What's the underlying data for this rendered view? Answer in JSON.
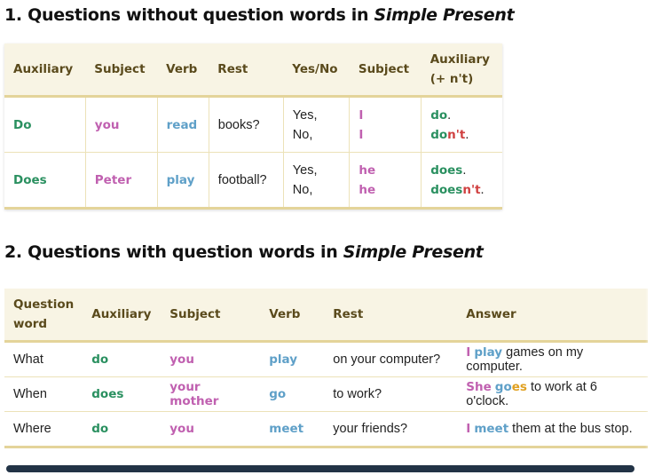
{
  "section1": {
    "title_plain": "1. Questions without question words in ",
    "title_italic": "Simple Present",
    "headers": [
      "Auxiliary",
      "Subject",
      "Verb",
      "Rest",
      "Yes/No",
      "Subject",
      "Auxiliary",
      "(+ n't)"
    ],
    "rows": [
      {
        "aux": "Do",
        "subject": "you",
        "verb": "read",
        "rest": "books?",
        "yes": "Yes,",
        "no": "No,",
        "s1": "I",
        "s2": "I",
        "a1": "do",
        "a2": "do",
        "nt": "n't",
        "dot": "."
      },
      {
        "aux": "Does",
        "subject": "Peter",
        "verb": "play",
        "rest": "football?",
        "yes": "Yes,",
        "no": "No,",
        "s1": "he",
        "s2": "he",
        "a1": "does",
        "a2": "does",
        "nt": "n't",
        "dot": "."
      }
    ]
  },
  "section2": {
    "title_plain": "2. Questions with question words in ",
    "title_italic": "Simple Present",
    "headers": [
      "Question",
      "word",
      "Auxiliary",
      "Subject",
      "Verb",
      "Rest",
      "Answer"
    ],
    "rows": [
      {
        "qword": "What",
        "aux": "do",
        "subject": "you",
        "verb": "play",
        "rest": "on your computer?",
        "ans_subj": "I",
        "ans_verb": "play",
        "ans_suffix": "",
        "ans_rest": " games on my computer."
      },
      {
        "qword": "When",
        "aux": "does",
        "subject": "your mother",
        "verb": "go",
        "rest": "to work?",
        "ans_subj": "She",
        "ans_verb": "go",
        "ans_suffix": "es",
        "ans_rest": " to work at 6 o'clock."
      },
      {
        "qword": "Where",
        "aux": "do",
        "subject": "you",
        "verb": "meet",
        "rest": "your friends?",
        "ans_subj": "I",
        "ans_verb": "meet",
        "ans_suffix": "",
        "ans_rest": " them at the bus stop."
      }
    ]
  },
  "colors": {
    "auxiliary": "#2a9060",
    "subject": "#c060b0",
    "verb": "#5fa0c8",
    "negation": "#d04040",
    "suffix": "#e0a020"
  }
}
